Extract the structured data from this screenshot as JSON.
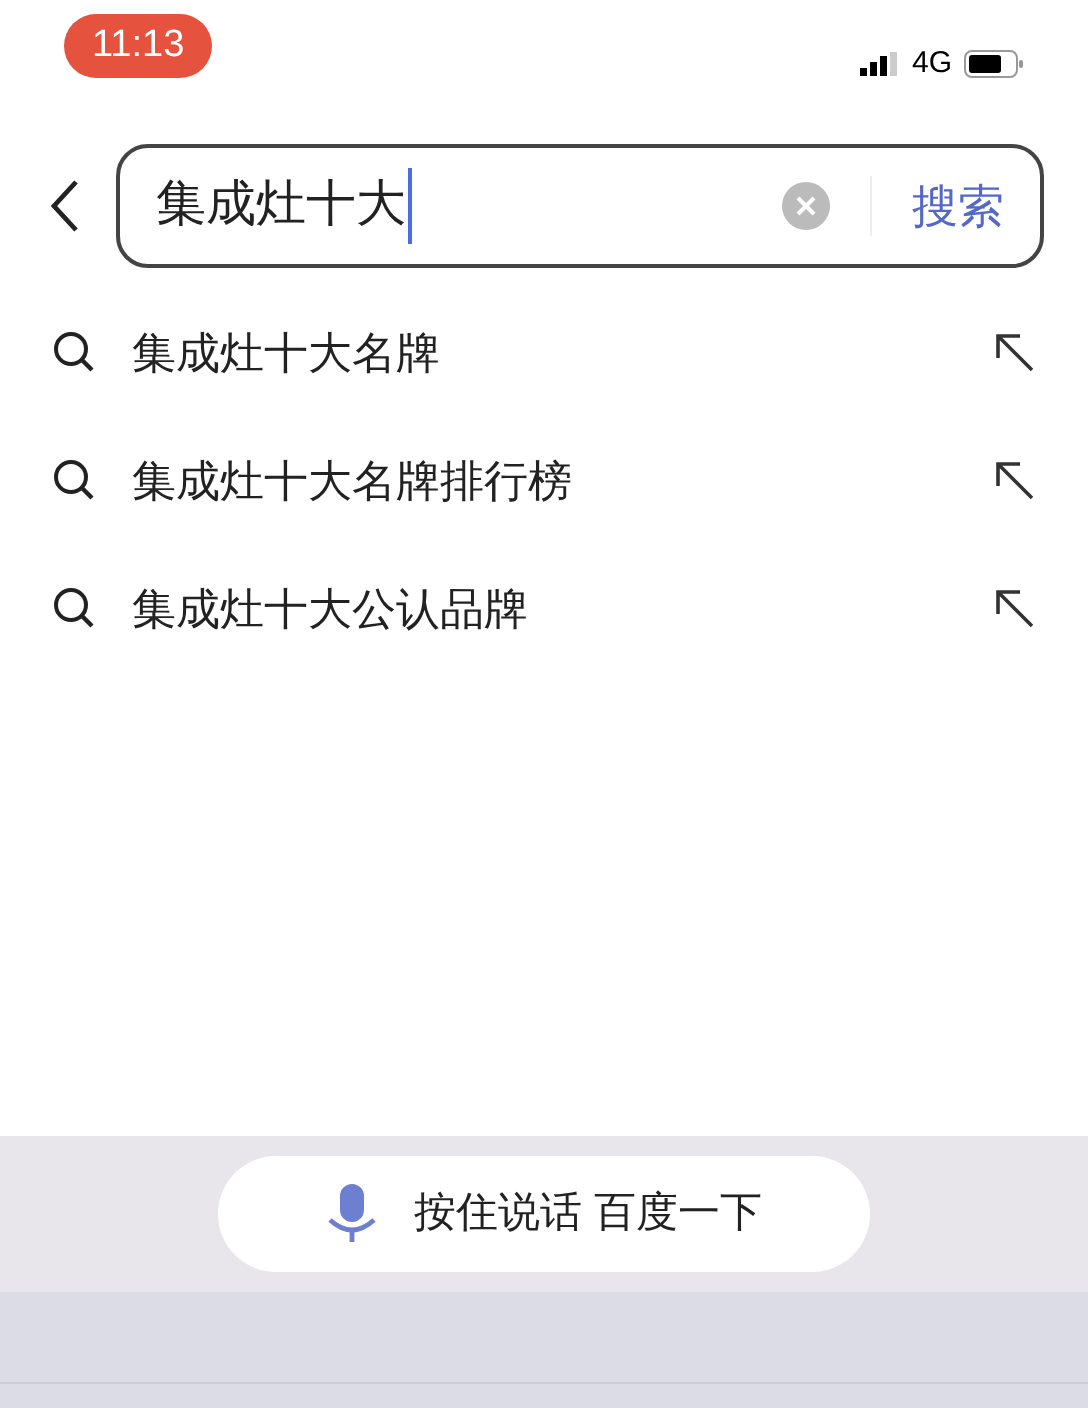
{
  "status_bar": {
    "time": "11:13",
    "network": "4G"
  },
  "search": {
    "value": "集成灶十大",
    "action": "搜索"
  },
  "suggestions": [
    {
      "text": "集成灶十大名牌"
    },
    {
      "text": "集成灶十大名牌排行榜"
    },
    {
      "text": "集成灶十大公认品牌"
    }
  ],
  "voice_button": {
    "label": "按住说话 百度一下"
  }
}
